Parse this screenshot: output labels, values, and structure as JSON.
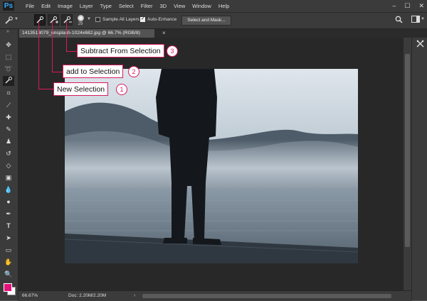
{
  "app": {
    "logo": "Ps"
  },
  "menu": [
    "File",
    "Edit",
    "Image",
    "Layer",
    "Type",
    "Select",
    "Filter",
    "3D",
    "View",
    "Window",
    "Help"
  ],
  "window_controls": {
    "minimize": "–",
    "maximize": "☐",
    "close": "✕"
  },
  "options": {
    "brush_size": "29",
    "sample_all_layers": {
      "label": "Sample All Layers",
      "checked": false
    },
    "auto_enhance": {
      "label": "Auto-Enhance",
      "checked": true
    },
    "select_mask_label": "Select and Mask..."
  },
  "document": {
    "tab_title": "1413513079_unsplash-1024x682.jpg @ 66.7% (RGB/8)",
    "close": "×"
  },
  "status": {
    "zoom": "66.67%",
    "doc_info": "Doc: 2.20M/2.20M",
    "arrow": "›"
  },
  "callouts": [
    {
      "label": "Subtract From Selection",
      "num": "3"
    },
    {
      "label": "add to Selection",
      "num": "2"
    },
    {
      "label": "New Selection",
      "num": "1"
    }
  ],
  "colors": {
    "foreground": "#e3127a",
    "background": "#ffffff",
    "annotation": "#d81b60"
  },
  "icons": [
    "quick-selection-icon",
    "move-icon",
    "marquee-icon",
    "lasso-icon",
    "crop-icon",
    "eyedropper-icon",
    "healing-icon",
    "brush-icon",
    "stamp-icon",
    "history-brush-icon",
    "eraser-icon",
    "gradient-icon",
    "blur-icon",
    "dodge-icon",
    "pen-icon",
    "type-icon",
    "path-select-icon",
    "shape-icon",
    "hand-icon",
    "zoom-icon",
    "more-icon",
    "search-icon",
    "workspace-icon",
    "tools-panel-icon"
  ]
}
